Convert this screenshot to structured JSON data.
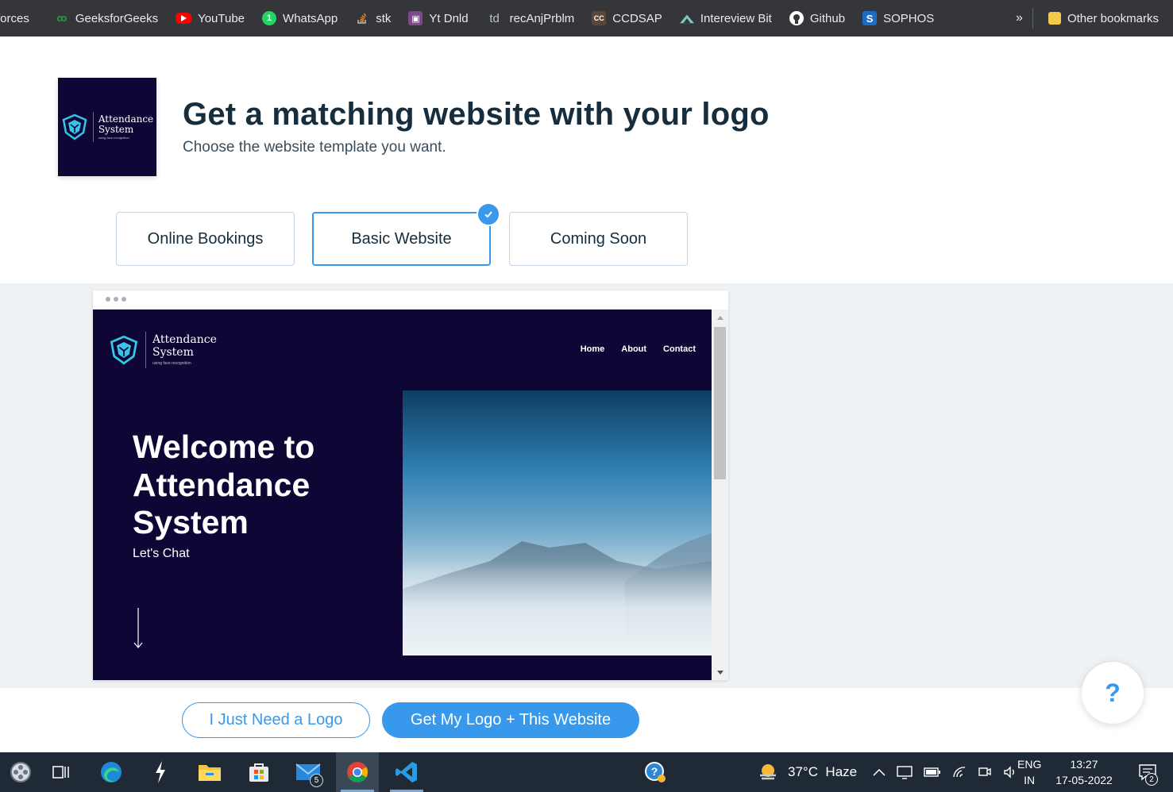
{
  "bookmarks": {
    "items": [
      {
        "label": "forces",
        "icon": "codeforces-icon"
      },
      {
        "label": "GeeksforGeeks",
        "icon": "geeksforgeeks-icon"
      },
      {
        "label": "YouTube",
        "icon": "youtube-icon"
      },
      {
        "label": "WhatsApp",
        "icon": "whatsapp-icon"
      },
      {
        "label": "stk",
        "icon": "stackoverflow-icon"
      },
      {
        "label": "Yt Dnld",
        "icon": "download-icon"
      },
      {
        "label": "recAnjPrblm",
        "icon": "td-icon",
        "icon_text": "td"
      },
      {
        "label": "CCDSAP",
        "icon": "cc-icon",
        "icon_text": "CC"
      },
      {
        "label": "Intereview Bit",
        "icon": "interviewbit-icon"
      },
      {
        "label": "Github",
        "icon": "github-icon"
      },
      {
        "label": "SOPHOS",
        "icon": "sophos-icon",
        "icon_text": "S"
      }
    ],
    "overflow": "»",
    "other": "Other bookmarks"
  },
  "header": {
    "title": "Get a matching website with your logo",
    "subtitle": "Choose the website template you want."
  },
  "logo": {
    "line1": "Attendance",
    "line2": "System",
    "tagline": "using face recognition"
  },
  "templates": {
    "options": [
      {
        "label": "Online Bookings",
        "selected": false
      },
      {
        "label": "Basic Website",
        "selected": true
      },
      {
        "label": "Coming Soon",
        "selected": false
      }
    ]
  },
  "preview": {
    "nav": [
      "Home",
      "About",
      "Contact"
    ],
    "hero_line1": "Welcome to",
    "hero_line2": "Attendance",
    "hero_line3": "System",
    "hero_sub": "Let's Chat"
  },
  "actions": {
    "logo_only": "I Just Need a Logo",
    "logo_website": "Get My Logo + This Website",
    "help": "?"
  },
  "taskbar": {
    "apps": [
      {
        "name": "media-player",
        "icon": "film-reel-icon"
      },
      {
        "name": "task-view",
        "icon": "task-view-icon"
      },
      {
        "name": "edge",
        "icon": "edge-icon"
      },
      {
        "name": "app-lightning",
        "icon": "lightning-app-icon"
      },
      {
        "name": "file-explorer",
        "icon": "folder-icon"
      },
      {
        "name": "store",
        "icon": "store-icon"
      },
      {
        "name": "mail",
        "icon": "mail-icon",
        "badge": "5"
      },
      {
        "name": "chrome",
        "icon": "chrome-icon"
      },
      {
        "name": "vscode",
        "icon": "vscode-icon"
      }
    ],
    "weather": "37°C  Haze",
    "lang_line1": "ENG",
    "lang_line2": "IN",
    "time": "13:27",
    "date": "17-05-2022",
    "notifications": "2"
  },
  "colors": {
    "accent": "#3899ec",
    "title": "#162d3d",
    "site_bg": "#0e0634",
    "preview_bg": "#eef2f5",
    "taskbar": "#1f2a36",
    "bookmarks_bar": "#35363a"
  }
}
